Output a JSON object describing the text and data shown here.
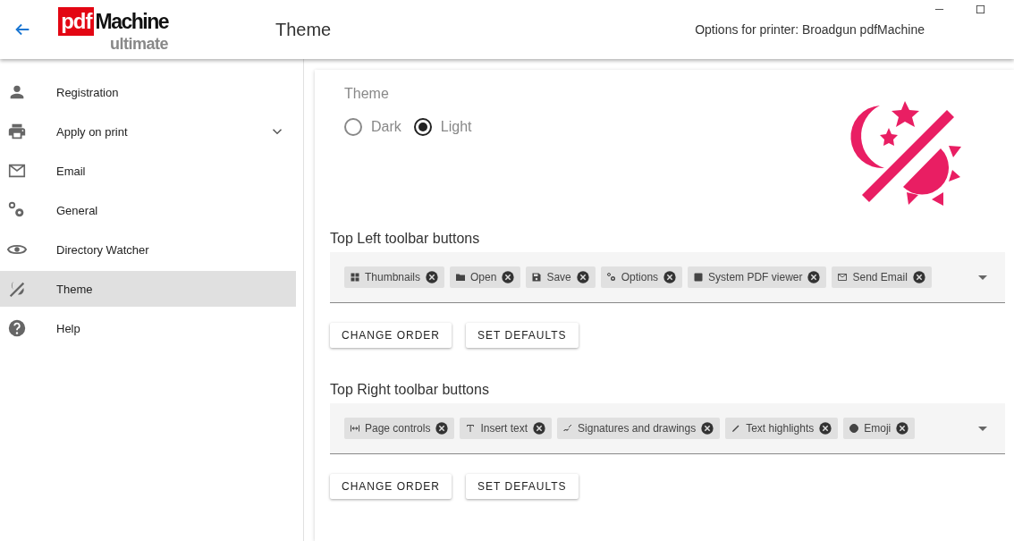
{
  "header": {
    "logo_red": "pdf",
    "logo_black": "Machine",
    "logo_sub": "ultimate",
    "title": "Theme",
    "printer": "Options for printer: Broadgun pdfMachine"
  },
  "sidebar": {
    "items": [
      {
        "label": "Registration",
        "selected": false,
        "expandable": false
      },
      {
        "label": "Apply on print",
        "selected": false,
        "expandable": true
      },
      {
        "label": "Email",
        "selected": false,
        "expandable": false
      },
      {
        "label": "General",
        "selected": false,
        "expandable": false
      },
      {
        "label": "Directory Watcher",
        "selected": false,
        "expandable": false
      },
      {
        "label": "Theme",
        "selected": true,
        "expandable": false
      },
      {
        "label": "Help",
        "selected": false,
        "expandable": false
      }
    ]
  },
  "theme": {
    "label": "Theme",
    "options": [
      {
        "label": "Dark",
        "selected": false
      },
      {
        "label": "Light",
        "selected": true
      }
    ]
  },
  "toolbars": [
    {
      "title": "Top Left toolbar buttons",
      "chips": [
        "Thumbnails",
        "Open",
        "Save",
        "Options",
        "System PDF viewer",
        "Send Email"
      ],
      "buttons": [
        "CHANGE ORDER",
        "SET DEFAULTS"
      ]
    },
    {
      "title": "Top Right toolbar buttons",
      "chips": [
        "Page controls",
        "Insert text",
        "Signatures and drawings",
        "Text highlights",
        "Emoji"
      ],
      "buttons": [
        "CHANGE ORDER",
        "SET DEFAULTS"
      ]
    }
  ]
}
